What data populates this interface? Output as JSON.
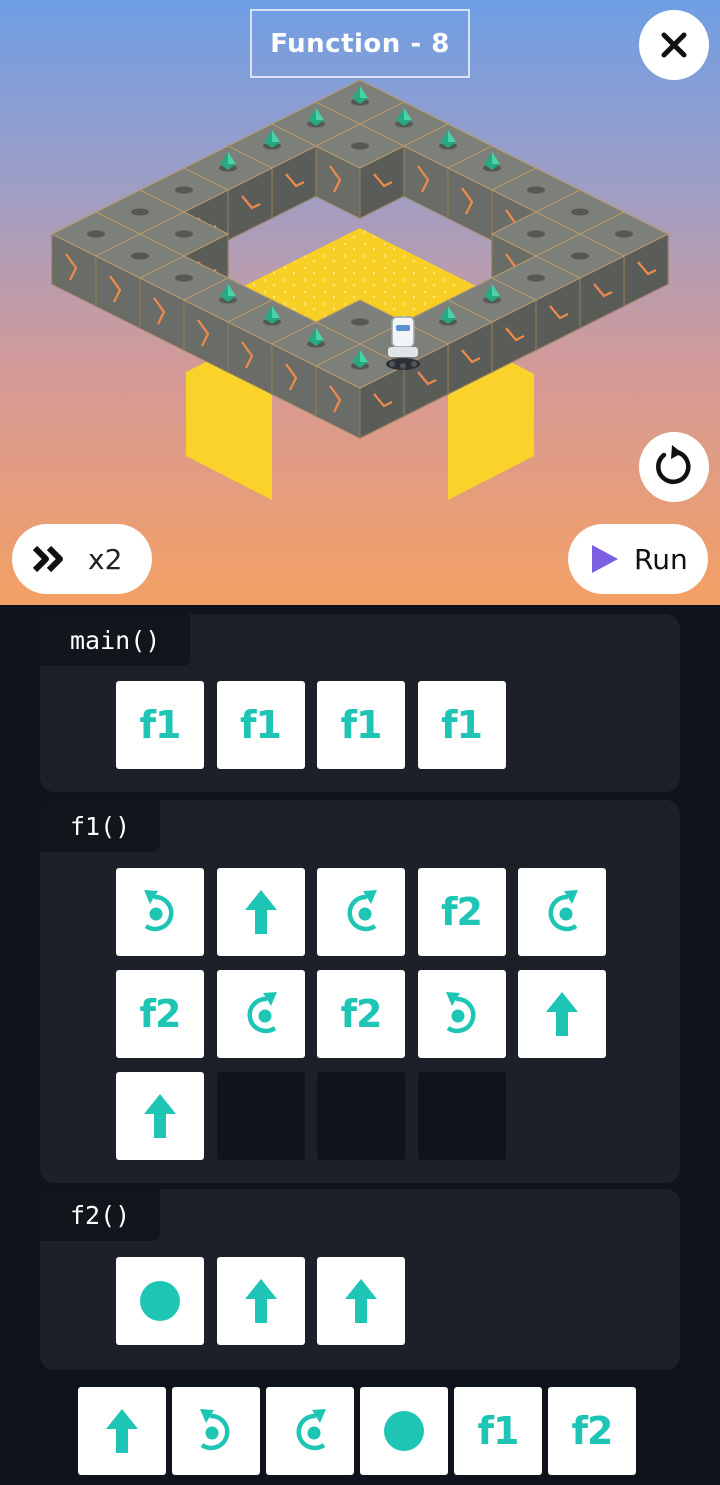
{
  "header": {
    "level_title": "Function - 8"
  },
  "controls": {
    "speed_label": "x2",
    "run_label": "Run"
  },
  "colors": {
    "accent": "#1ec5b5",
    "run_triangle": "#7b5fe0",
    "panel": "#1b2029",
    "background": "#0f131b"
  },
  "procedures": {
    "main": {
      "label": "main()",
      "slots": [
        "f1",
        "f1",
        "f1",
        "f1"
      ]
    },
    "f1": {
      "label": "f1()",
      "slots": [
        "turn-left",
        "forward",
        "turn-right",
        "f2",
        "turn-right",
        "f2",
        "turn-right",
        "f2",
        "turn-left",
        "forward",
        "forward",
        "",
        "",
        ""
      ]
    },
    "f2": {
      "label": "f2()",
      "slots": [
        "light",
        "forward",
        "forward"
      ]
    }
  },
  "palette": {
    "items": [
      "forward",
      "turn-left",
      "turn-right",
      "light",
      "f1",
      "f2"
    ]
  },
  "icons": {
    "close": "close-icon",
    "reset": "reset-icon",
    "speed": "fast-forward-icon",
    "run": "play-icon",
    "forward": "arrow-up-icon",
    "turn-left": "turn-left-icon",
    "turn-right": "turn-right-icon",
    "light": "light-dot-icon"
  }
}
